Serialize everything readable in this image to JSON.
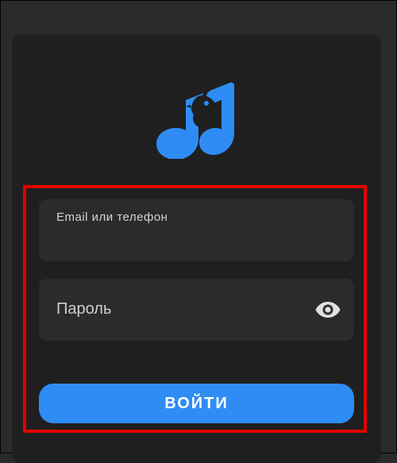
{
  "form": {
    "email_label": "Email или телефон",
    "password_placeholder": "Пароль",
    "login_button": "ВОЙТИ"
  },
  "icons": {
    "logo": "music-note-bird-icon",
    "password_toggle": "eye-icon"
  },
  "colors": {
    "accent": "#2f8cf5",
    "highlight_border": "#e50000",
    "card_background": "#1f1f1f",
    "field_background": "#2b2b2b"
  }
}
